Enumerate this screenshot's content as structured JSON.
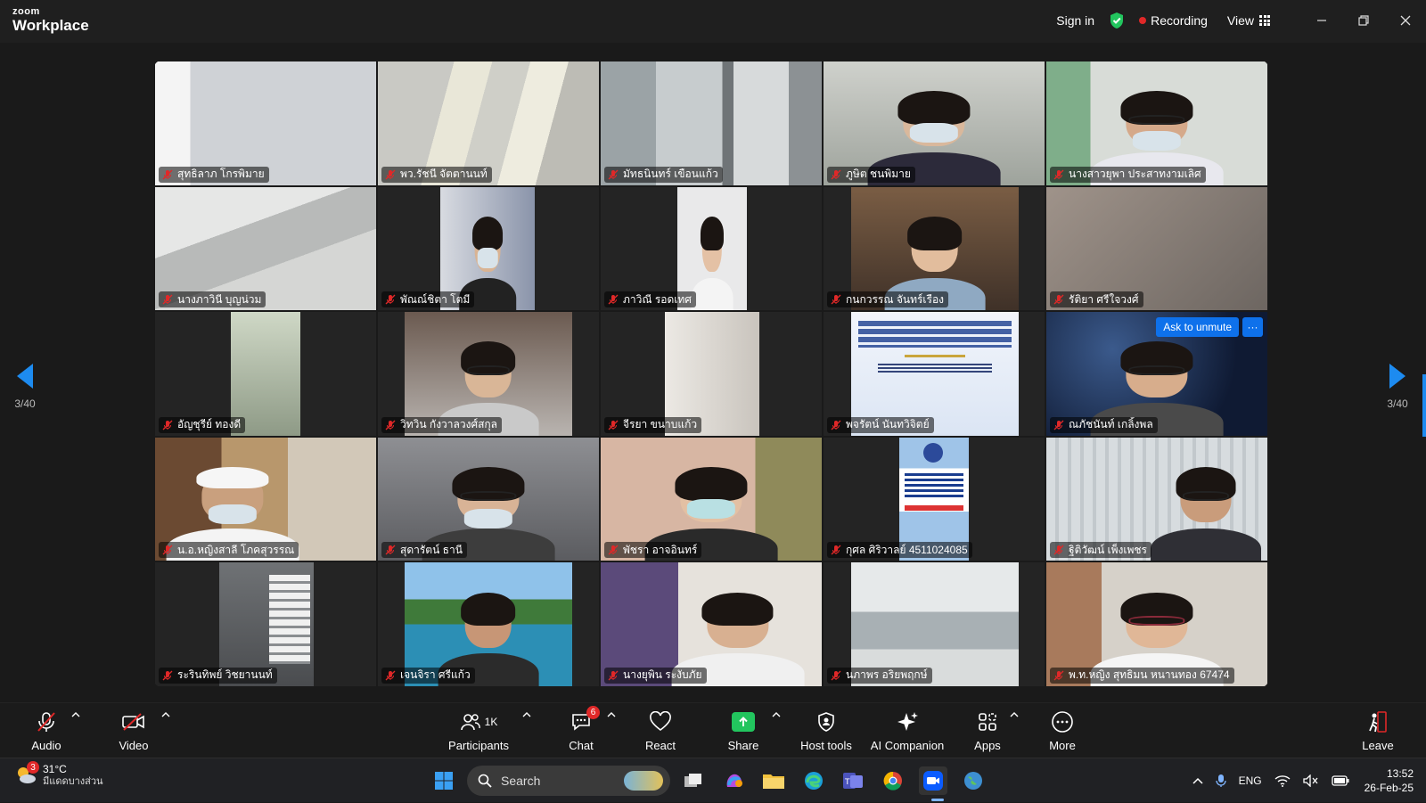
{
  "titlebar": {
    "logo_top": "zoom",
    "logo_bottom": "Workplace",
    "sign_in": "Sign in",
    "recording": "Recording",
    "view": "View"
  },
  "gallery": {
    "page_left": "3/40",
    "page_right": "3/40",
    "ask_to_unmute": "Ask to unmute",
    "more_dots": "···",
    "participants": [
      {
        "name": "สุทธิลาภ โกรพิมาย"
      },
      {
        "name": "พว.รัชนี จัตตานนท์"
      },
      {
        "name": "มัทธนินทร์ เขือนแก้ว"
      },
      {
        "name": "ภูษิต ชนพิมาย"
      },
      {
        "name": "นางสาวยุพา ประสาทงามเลิศ"
      },
      {
        "name": "นางภาวินี บุญน่วม"
      },
      {
        "name": "พัณณ์ชิตา โตมี"
      },
      {
        "name": "ภาวิณี รอดเทศ"
      },
      {
        "name": "กนกวรรณ จันทร์เรือง"
      },
      {
        "name": "รัติยา ศรีใจวงศ์"
      },
      {
        "name": "อัญชุรีย์ ทองดี"
      },
      {
        "name": "วิทวิน กังวาลวงศ์สกุล"
      },
      {
        "name": "จีรยา ขนาบแก้ว"
      },
      {
        "name": "พจรัตน์ นันทวิจิตย์"
      },
      {
        "name": "ณภัชนันท์ เกลิ้งพล"
      },
      {
        "name": "น.อ.หญิงสาลี โภคสุวรรณ"
      },
      {
        "name": "สุดารัตน์ ธานี"
      },
      {
        "name": "พัชรา อาจอินทร์"
      },
      {
        "name": "กุศล ศิริวาลย์ 4511024085"
      },
      {
        "name": "ฐิติวัฒน์ เพ็งเพชร"
      },
      {
        "name": "ระรินทิพย์ วิชยานนท์"
      },
      {
        "name": "เจนจิรา ศรีแก้ว"
      },
      {
        "name": "นางยุพิน ระงับภัย"
      },
      {
        "name": "นภาพร อริยพฤกษ์"
      },
      {
        "name": "พ.ท.หญิง สุทธิมน หนานทอง 67474"
      }
    ]
  },
  "toolbar": {
    "audio": "Audio",
    "video": "Video",
    "participants": "Participants",
    "participants_count": "1K",
    "chat": "Chat",
    "chat_badge": "6",
    "react": "React",
    "share": "Share",
    "host_tools": "Host tools",
    "ai_companion": "AI Companion",
    "apps": "Apps",
    "more": "More",
    "leave": "Leave"
  },
  "taskbar": {
    "weather_badge": "3",
    "temperature": "31°C",
    "condition": "มีแดดบางส่วน",
    "search_placeholder": "Search",
    "language": "ENG",
    "time": "13:52",
    "date": "26-Feb-25"
  },
  "colors": {
    "accent": "#0e71eb",
    "nav_arrow": "#1d8bf0",
    "recording_dot": "#e02828",
    "share_green": "#22c55e",
    "shield_green": "#22c55e"
  }
}
